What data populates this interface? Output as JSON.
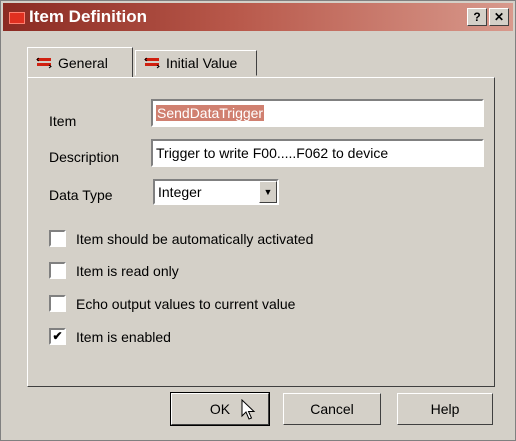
{
  "window": {
    "title": "Item Definition",
    "help_label": "?",
    "close_label": "✕"
  },
  "tabs": [
    {
      "label": "General"
    },
    {
      "label": "Initial Value"
    }
  ],
  "form": {
    "item_label": "Item",
    "item_value": "SendDataTrigger",
    "description_label": "Description",
    "description_value": "Trigger to write F00.....F062 to device",
    "data_type_label": "Data Type",
    "data_type_value": "Integer"
  },
  "checkboxes": [
    {
      "label": "Item should be automatically activated",
      "checked": false
    },
    {
      "label": "Item is read only",
      "checked": false
    },
    {
      "label": "Echo output values to current value",
      "checked": false
    },
    {
      "label": "Item is enabled",
      "checked": true
    }
  ],
  "buttons": {
    "ok": "OK",
    "cancel": "Cancel",
    "help": "Help"
  },
  "colors": {
    "title_gradient_start": "#8a2a22",
    "selection": "#d08070"
  }
}
